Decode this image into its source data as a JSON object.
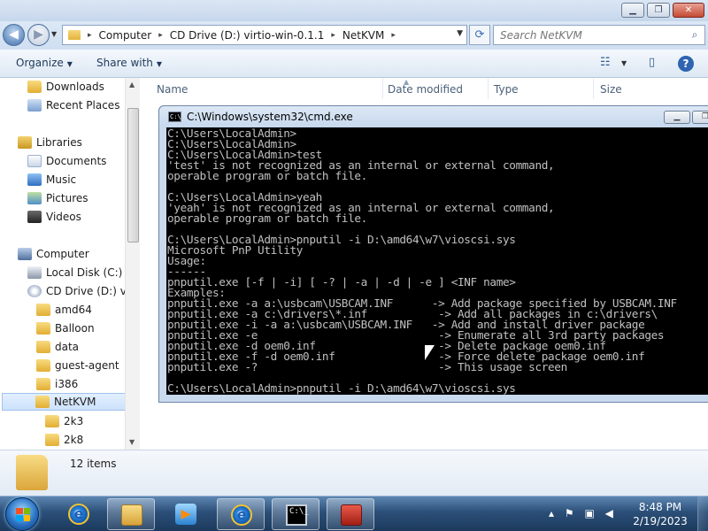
{
  "explorer": {
    "address": {
      "crumbs": [
        "Computer",
        "CD Drive (D:) virtio-win-0.1.1",
        "NetKVM"
      ]
    },
    "search": {
      "placeholder": "Search NetKVM"
    },
    "toolbar": {
      "organize": "Organize",
      "share_with": "Share with"
    },
    "nav": {
      "items": [
        {
          "label": "Downloads",
          "icon": "downloads-folder-icon"
        },
        {
          "label": "Recent Places",
          "icon": "recent-places-icon"
        },
        {
          "label": "Libraries",
          "icon": "libraries-icon"
        },
        {
          "label": "Documents",
          "icon": "documents-icon"
        },
        {
          "label": "Music",
          "icon": "music-icon"
        },
        {
          "label": "Pictures",
          "icon": "pictures-icon"
        },
        {
          "label": "Videos",
          "icon": "videos-icon"
        },
        {
          "label": "Computer",
          "icon": "computer-icon"
        },
        {
          "label": "Local Disk (C:)",
          "icon": "local-disk-icon"
        },
        {
          "label": "CD Drive (D:) virt",
          "icon": "cd-drive-icon"
        },
        {
          "label": "amd64",
          "icon": "folder-icon"
        },
        {
          "label": "Balloon",
          "icon": "folder-icon"
        },
        {
          "label": "data",
          "icon": "folder-icon"
        },
        {
          "label": "guest-agent",
          "icon": "folder-icon"
        },
        {
          "label": "i386",
          "icon": "folder-icon"
        },
        {
          "label": "NetKVM",
          "icon": "folder-icon",
          "selected": true
        },
        {
          "label": "2k3",
          "icon": "folder-icon"
        },
        {
          "label": "2k8",
          "icon": "folder-icon"
        }
      ]
    },
    "columns": [
      "Name",
      "Date modified",
      "Type",
      "Size"
    ],
    "details": {
      "item_count": "12 items"
    }
  },
  "cmd": {
    "title": "C:\\Windows\\system32\\cmd.exe",
    "lines": [
      "C:\\Users\\LocalAdmin>",
      "C:\\Users\\LocalAdmin>",
      "C:\\Users\\LocalAdmin>test",
      "'test' is not recognized as an internal or external command,",
      "operable program or batch file.",
      "",
      "C:\\Users\\LocalAdmin>yeah",
      "'yeah' is not recognized as an internal or external command,",
      "operable program or batch file.",
      "",
      "C:\\Users\\LocalAdmin>pnputil -i D:\\amd64\\w7\\vioscsi.sys",
      "Microsoft PnP Utility",
      "Usage:",
      "------",
      "pnputil.exe [-f | -i] [ -? | -a | -d | -e ] <INF name>",
      "Examples:",
      "pnputil.exe -a a:\\usbcam\\USBCAM.INF      -> Add package specified by USBCAM.INF",
      "pnputil.exe -a c:\\drivers\\*.inf           -> Add all packages in c:\\drivers\\",
      "pnputil.exe -i -a a:\\usbcam\\USBCAM.INF   -> Add and install driver package",
      "pnputil.exe -e                            -> Enumerate all 3rd party packages",
      "pnputil.exe -d oem0.inf                   -> Delete package oem0.inf",
      "pnputil.exe -f -d oem0.inf                -> Force delete package oem0.inf",
      "pnputil.exe -?                            -> This usage screen",
      "",
      "C:\\Users\\LocalAdmin>pnputil -i D:\\amd64\\w7\\vioscsi.sys"
    ]
  },
  "taskbar": {
    "apps": [
      "internet-explorer",
      "windows-explorer",
      "media-player",
      "internet-explorer",
      "command-prompt",
      "toolbox"
    ],
    "time": "8:48 PM",
    "date": "2/19/2023"
  }
}
